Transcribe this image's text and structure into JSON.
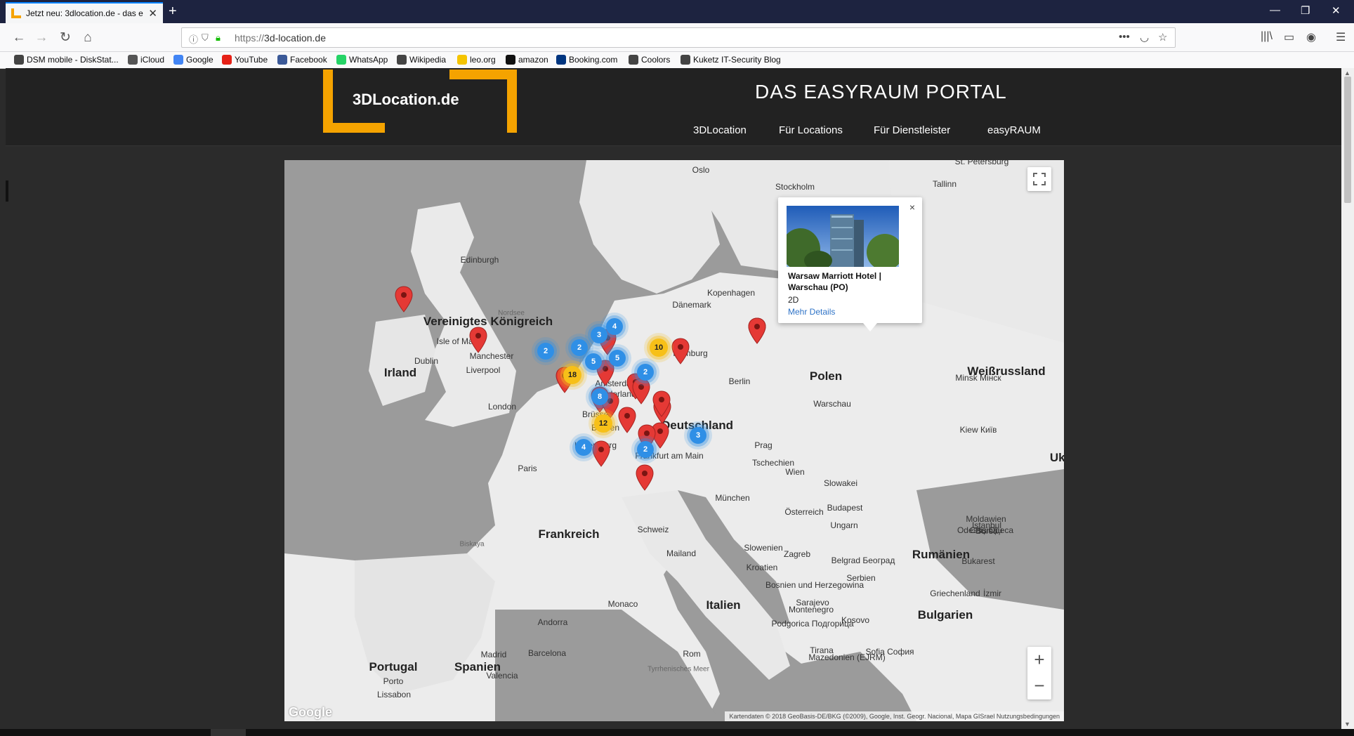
{
  "browser": {
    "tab_title": "Jetzt neu: 3dlocation.de - das e",
    "url_scheme": "https://",
    "url_host": "3d-location.de",
    "bookmarks": [
      {
        "label": "DSM mobile - DiskStat...",
        "icon": "globe-icon",
        "color": "#444444"
      },
      {
        "label": "iCloud",
        "icon": "apple-icon",
        "color": "#555555"
      },
      {
        "label": "Google",
        "icon": "google-icon",
        "color": "#4285f4"
      },
      {
        "label": "YouTube",
        "icon": "youtube-icon",
        "color": "#e62117"
      },
      {
        "label": "Facebook",
        "icon": "facebook-icon",
        "color": "#3b5998"
      },
      {
        "label": "WhatsApp",
        "icon": "whatsapp-icon",
        "color": "#25d366"
      },
      {
        "label": "Wikipedia",
        "icon": "globe-icon",
        "color": "#444444"
      },
      {
        "label": "leo.org",
        "icon": "leo-icon",
        "color": "#f5c400"
      },
      {
        "label": "amazon",
        "icon": "amazon-icon",
        "color": "#111111"
      },
      {
        "label": "Booking.com",
        "icon": "booking-icon",
        "color": "#003580"
      },
      {
        "label": "Coolors",
        "icon": "globe-icon",
        "color": "#444444"
      },
      {
        "label": "Kuketz IT-Security Blog",
        "icon": "rss-icon",
        "color": "#444444"
      }
    ]
  },
  "site": {
    "logo_text": "3DLocation.de",
    "brand_color": "#f5a300",
    "portal_title": "DAS EASYRAUM PORTAL",
    "nav": [
      "3DLocation",
      "Für Locations",
      "Für Dienstleister",
      "easyRAUM"
    ]
  },
  "map": {
    "country_labels": [
      "Vereinigtes Königreich",
      "Irland",
      "Frankreich",
      "Deutschland",
      "Polen",
      "Weißrussland",
      "Ukraine",
      "Italien",
      "Spanien",
      "Portugal",
      "Rumänien",
      "Bulgarien"
    ],
    "city_labels": [
      "Oslo",
      "Stockholm",
      "Tallinn",
      "Edinburgh",
      "Isle of Man",
      "Manchester",
      "Liverpool",
      "Dublin",
      "London",
      "Kopenhagen",
      "Dänemark",
      "Hamburg",
      "Amsterdam",
      "Niederlande",
      "Brüssel",
      "Belgien",
      "Luxemburg",
      "Frankfurt am Main",
      "Paris",
      "Prag",
      "Tschechien",
      "Berlin",
      "Warschau",
      "Minsk Мінск",
      "Kiew Київ",
      "Slowakei",
      "Budapest",
      "Ungarn",
      "Wien",
      "Österreich",
      "München",
      "Schweiz",
      "Mailand",
      "Slowenien",
      "Zagreb",
      "Kroatien",
      "Belgrad Београд",
      "Serbien",
      "Bosnien und Herzegowina",
      "Sarajevo",
      "Montenegro",
      "Podgorica Подгорица",
      "Kosovo",
      "Tirana",
      "Mazedonien (EJRM)",
      "Sofia София",
      "Bukarest",
      "Moldawien",
      "Chișinău",
      "Odessa Одеса",
      "Istanbul",
      "Bursa",
      "İzmir",
      "Griechenland",
      "Monaco",
      "Andorra",
      "Barcelona",
      "Madrid",
      "Valencia",
      "Porto",
      "Lissabon",
      "Rom",
      "Tyrrhenisches Meer",
      "Biskaya",
      "Nordsee",
      "St. Petersburg"
    ],
    "clusters": [
      {
        "count": "2",
        "color": "blue"
      },
      {
        "count": "2",
        "color": "blue"
      },
      {
        "count": "3",
        "color": "blue"
      },
      {
        "count": "4",
        "color": "blue"
      },
      {
        "count": "5",
        "color": "blue"
      },
      {
        "count": "5",
        "color": "blue"
      },
      {
        "count": "10",
        "color": "yellow"
      },
      {
        "count": "18",
        "color": "yellow"
      },
      {
        "count": "2",
        "color": "blue"
      },
      {
        "count": "8",
        "color": "blue"
      },
      {
        "count": "12",
        "color": "yellow"
      },
      {
        "count": "4",
        "color": "blue"
      },
      {
        "count": "2",
        "color": "blue"
      },
      {
        "count": "3",
        "color": "blue"
      }
    ],
    "popup": {
      "title": "Warsaw Marriott Hotel | Warschau (PO)",
      "kind": "2D",
      "link": "Mehr Details",
      "close": "×"
    },
    "google_logo": "Google",
    "attribution": "Kartendaten © 2018 GeoBasis-DE/BKG (©2009), Google, Inst. Geogr. Nacional, Mapa GISrael   Nutzungsbedingungen",
    "zoom_in": "+",
    "zoom_out": "−"
  }
}
